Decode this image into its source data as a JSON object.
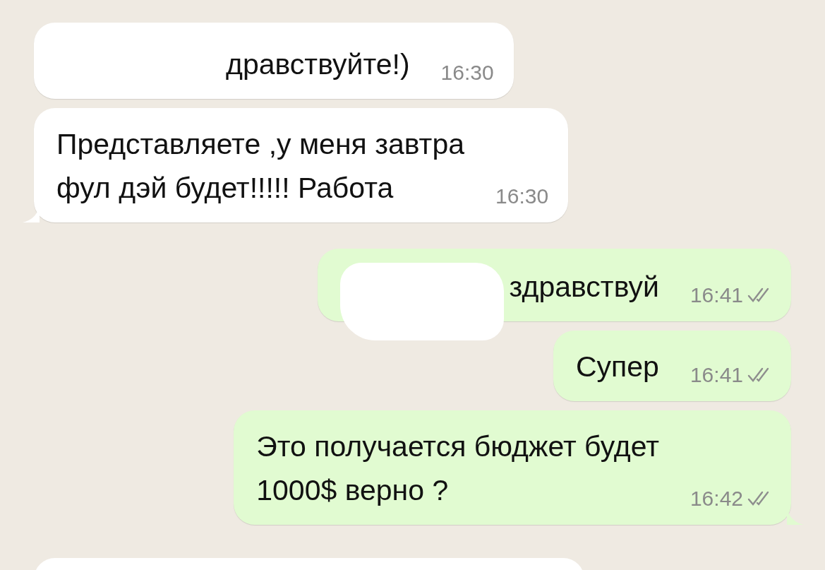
{
  "messages": [
    {
      "outgoing": false,
      "redacted": true,
      "tail": false,
      "lines": [
        "дравствуйте!)"
      ],
      "time": "16:30"
    },
    {
      "outgoing": false,
      "redacted": false,
      "tail": true,
      "lines": [
        "Представляете ,у меня завтра",
        "фул дэй будет!!!!! Работа"
      ],
      "time": "16:30"
    },
    {
      "outgoing": true,
      "redacted": true,
      "tail": false,
      "lines": [
        "здравствуй"
      ],
      "time": "16:41",
      "read": false
    },
    {
      "outgoing": true,
      "redacted": false,
      "tail": false,
      "lines": [
        "Супер"
      ],
      "time": "16:41",
      "read": false
    },
    {
      "outgoing": true,
      "redacted": false,
      "tail": true,
      "lines": [
        "Это получается бюджет будет",
        "1000$ верно ?"
      ],
      "time": "16:42",
      "read": false
    }
  ]
}
